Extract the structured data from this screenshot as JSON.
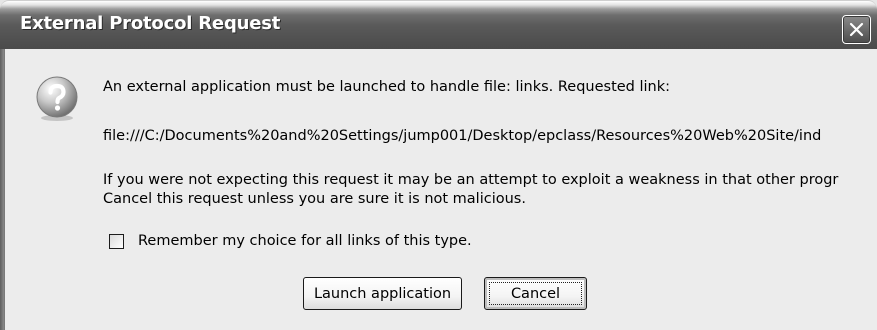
{
  "window": {
    "title": "External Protocol Request",
    "close_icon": "close-icon"
  },
  "dialog": {
    "icon": "question-icon",
    "message_line_1": "An external application must be launched to handle file: links. Requested link:",
    "requested_link": "file:///C:/Documents%20and%20Settings/jump001/Desktop/epclass/Resources%20Web%20Site/ind",
    "warning_line_1": "If you were not expecting this request it may be an attempt to exploit a weakness in that other progr",
    "warning_line_2": "Cancel this request unless you are sure it is not malicious.",
    "remember_choice": {
      "label": "Remember my choice for all links of this type.",
      "checked": false
    }
  },
  "buttons": {
    "launch_label": "Launch application",
    "cancel_label": "Cancel",
    "default": "cancel"
  }
}
